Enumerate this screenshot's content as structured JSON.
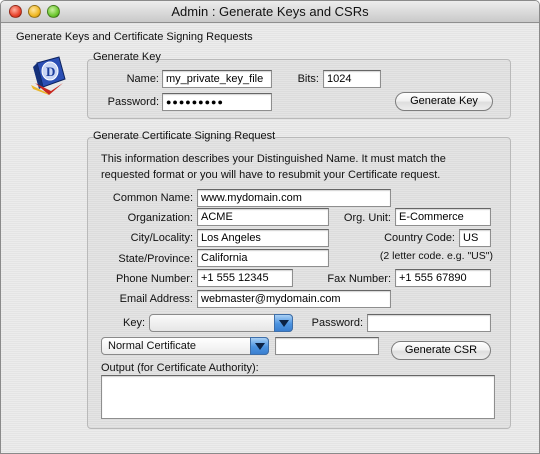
{
  "window": {
    "title": "Admin : Generate Keys and CSRs"
  },
  "page": {
    "heading": "Generate Keys and Certificate Signing Requests"
  },
  "generate_key": {
    "section_title": "Generate Key",
    "name_label": "Name:",
    "name_value": "my_private_key_file",
    "bits_label": "Bits:",
    "bits_value": "1024",
    "password_label": "Password:",
    "password_value": "●●●●●●●●●",
    "button_label": "Generate Key"
  },
  "csr": {
    "section_title": "Generate Certificate Signing Request",
    "info_line1": "This information describes your Distinguished Name. It must match the",
    "info_line2": "requested format or you will have to resubmit your Certificate request.",
    "common_name_label": "Common Name:",
    "common_name_value": "www.mydomain.com",
    "organization_label": "Organization:",
    "organization_value": "ACME",
    "org_unit_label": "Org. Unit:",
    "org_unit_value": "E-Commerce",
    "city_label": "City/Locality:",
    "city_value": "Los Angeles",
    "country_label": "Country Code:",
    "country_value": "US",
    "country_hint": "(2 letter code. e.g. \"US\")",
    "state_label": "State/Province:",
    "state_value": "California",
    "phone_label": "Phone Number:",
    "phone_value": "+1 555 12345",
    "fax_label": "Fax Number:",
    "fax_value": "+1 555 67890",
    "email_label": "Email Address:",
    "email_value": "webmaster@mydomain.com",
    "key_label": "Key:",
    "key_selected": "",
    "password_label": "Password:",
    "password_value": "",
    "cert_type_selected": "Normal Certificate",
    "extra_field_value": "",
    "button_label": "Generate CSR",
    "output_label": "Output (for Certificate Authority):",
    "output_value": ""
  },
  "colors": {
    "popup_arrow": "#4c93e0",
    "window_bg": "#e8e8e8"
  },
  "icons": {
    "app": "certificate-app-icon",
    "dropdown": "chevron-down-icon"
  }
}
